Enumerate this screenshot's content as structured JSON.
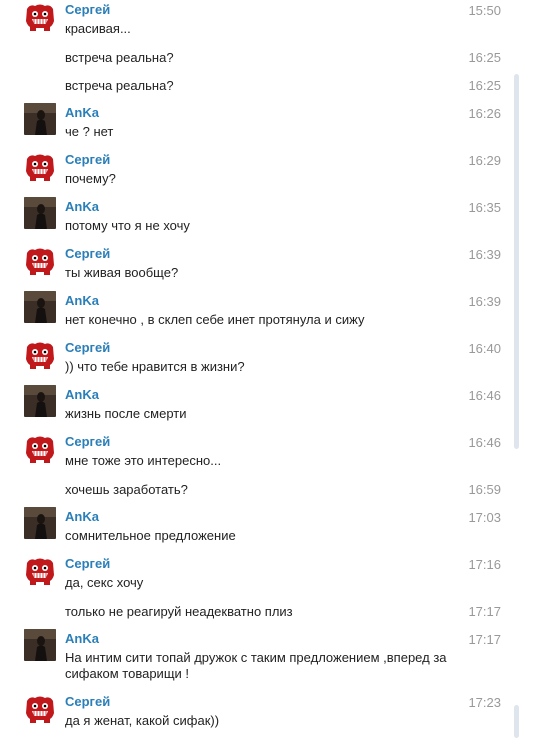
{
  "names": {
    "sergey": "Сергей",
    "anka": "AnKa"
  },
  "messages": [
    {
      "sender": "Сергей",
      "avatar": "meat-boy",
      "time": "15:50",
      "text": "красивая..."
    },
    {
      "sender": "",
      "avatar": "",
      "time": "16:25",
      "text": "встреча реальна?"
    },
    {
      "sender": "",
      "avatar": "",
      "time": "16:25",
      "text": "встреча реальна?"
    },
    {
      "sender": "AnKa",
      "avatar": "dark-photo",
      "time": "16:26",
      "text": "че ? нет"
    },
    {
      "sender": "Сергей",
      "avatar": "meat-boy",
      "time": "16:29",
      "text": "почему?"
    },
    {
      "sender": "AnKa",
      "avatar": "dark-photo",
      "time": "16:35",
      "text": "потому что я не хочу"
    },
    {
      "sender": "Сергей",
      "avatar": "meat-boy",
      "time": "16:39",
      "text": "ты живая вообще?"
    },
    {
      "sender": "AnKa",
      "avatar": "dark-photo",
      "time": "16:39",
      "text": "нет конечно , в склеп себе инет протянула и сижу"
    },
    {
      "sender": "Сергей",
      "avatar": "meat-boy",
      "time": "16:40",
      "text": ")) что тебе нравится в жизни?"
    },
    {
      "sender": "AnKa",
      "avatar": "dark-photo",
      "time": "16:46",
      "text": "жизнь после смерти"
    },
    {
      "sender": "Сергей",
      "avatar": "meat-boy",
      "time": "16:46",
      "text": "мне тоже это интересно..."
    },
    {
      "sender": "",
      "avatar": "",
      "time": "16:59",
      "text": "хочешь заработать?"
    },
    {
      "sender": "AnKa",
      "avatar": "dark-photo",
      "time": "17:03",
      "text": "сомнительное предложение"
    },
    {
      "sender": "Сергей",
      "avatar": "meat-boy",
      "time": "17:16",
      "text": "да, секс хочу"
    },
    {
      "sender": "",
      "avatar": "",
      "time": "17:17",
      "text": "только не реагируй неадекватно плиз"
    },
    {
      "sender": "AnKa",
      "avatar": "dark-photo",
      "time": "17:17",
      "text": "На интим сити топай дружок с таким предложением ,вперед за сифаком товарищи !"
    },
    {
      "sender": "Сергей",
      "avatar": "meat-boy",
      "time": "17:23",
      "text": "да я женат, какой сифак))"
    }
  ]
}
